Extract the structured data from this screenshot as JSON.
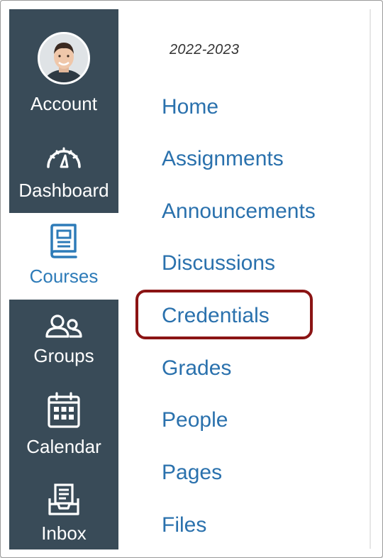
{
  "global_nav": {
    "items": [
      {
        "key": "account",
        "label": "Account",
        "icon": "avatar"
      },
      {
        "key": "dashboard",
        "label": "Dashboard",
        "icon": "speedometer-icon"
      },
      {
        "key": "courses",
        "label": "Courses",
        "icon": "book-icon",
        "active": true
      },
      {
        "key": "groups",
        "label": "Groups",
        "icon": "people-icon"
      },
      {
        "key": "calendar",
        "label": "Calendar",
        "icon": "calendar-icon"
      },
      {
        "key": "inbox",
        "label": "Inbox",
        "icon": "inbox-icon"
      }
    ]
  },
  "course_nav": {
    "term": "2022-2023",
    "links": [
      "Home",
      "Assignments",
      "Announcements",
      "Discussions",
      "Credentials",
      "Grades",
      "People",
      "Pages",
      "Files"
    ],
    "highlighted": "Credentials"
  },
  "colors": {
    "nav_background": "#394b58",
    "link": "#2a71ad",
    "active": "#2d7bb8",
    "highlight_border": "#8b1414"
  }
}
